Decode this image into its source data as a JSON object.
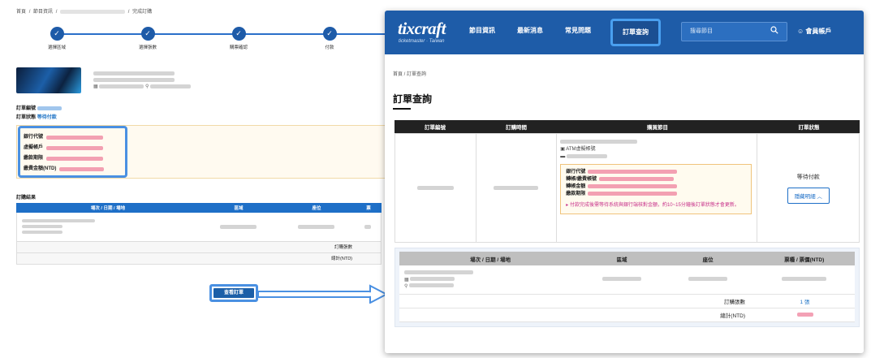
{
  "left_page": {
    "breadcrumb": [
      "首頁",
      "/",
      "節目資訊",
      "/",
      "完成訂購"
    ],
    "steps": [
      "選擇區域",
      "選擇張數",
      "購票確認",
      "付款"
    ],
    "order_no_label": "訂單編號",
    "order_status_label": "訂單狀態",
    "order_status_value": "等待付款",
    "pay_labels": [
      "銀行代號",
      "虛擬帳戶",
      "繳款期限",
      "繳費金額(NTD)"
    ],
    "result_title": "訂購結果",
    "table_headers": [
      "場次 / 日期 / 場地",
      "區域",
      "座位",
      "票"
    ],
    "ticket_count_label": "訂購張數",
    "total_label": "總計(NTD)",
    "view_order_button": "查看訂單"
  },
  "right_page": {
    "logo": "tixcraft",
    "logo_sub": "ticketmaster · Taiwan",
    "nav": [
      "節目資訊",
      "最新消息",
      "常見問題"
    ],
    "nav_active": "訂單查詢",
    "search_placeholder": "搜尋節目",
    "member": "會員帳戶",
    "breadcrumb": "首頁 / 訂單查詢",
    "page_title": "訂單查詢",
    "table_headers": [
      "訂單編號",
      "訂購時間",
      "購買節目",
      "訂單狀態"
    ],
    "atm_label": "ATM虛擬帳號",
    "atm_fields": [
      "銀行代號",
      "轉帳/繳費帳號",
      "轉帳金額",
      "繳款期限"
    ],
    "note": "付款完成後需等待系統與銀行端核對金額，約10~15分鐘後訂單狀態才會更新。",
    "status": "等待付款",
    "hide_button": "隱藏明細 ︿",
    "sub_headers": [
      "場次 / 日期 / 場地",
      "區域",
      "座位",
      "票種 / 票價(NTD)"
    ],
    "ticket_count_label": "訂購張數",
    "ticket_count_value": "1 張",
    "total_label": "總計(NTD)"
  },
  "colors": {
    "brand_blue": "#1e5ca8",
    "highlight": "#4a90e2",
    "status_blue": "#1f74c6",
    "pink": "#c7318a"
  }
}
